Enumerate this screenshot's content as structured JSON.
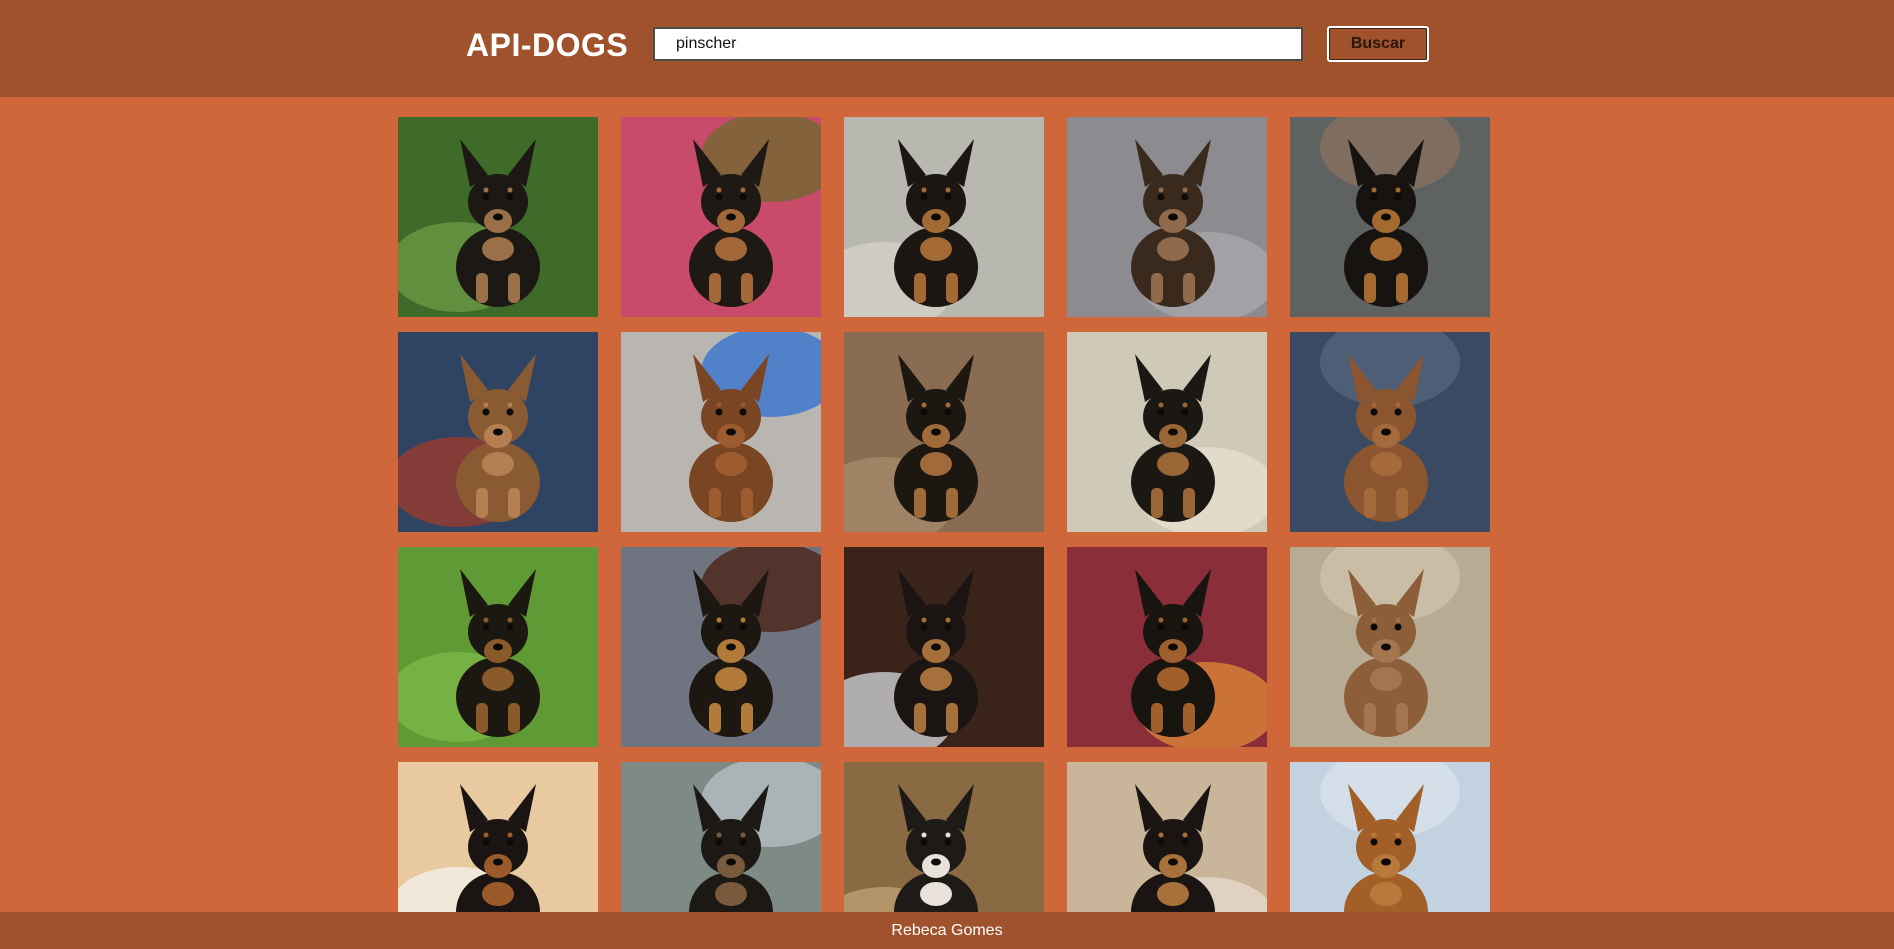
{
  "header": {
    "logo": "API-DOGS",
    "search_value": "pinscher",
    "search_button_label": "Buscar"
  },
  "gallery": {
    "photos": [
      {
        "background": "#3f6b2a",
        "accent": "#6f9b45",
        "dog": "#1c1814",
        "tan": "#9a7048"
      },
      {
        "background": "#c94b6a",
        "accent": "#6b6a2e",
        "dog": "#1e1915",
        "tan": "#a3683a"
      },
      {
        "background": "#b8b7b0",
        "accent": "#d6d3c8",
        "dog": "#1b1612",
        "tan": "#a36a34"
      },
      {
        "background": "#8c8b90",
        "accent": "#a9a8ad",
        "dog": "#3a2a1e",
        "tan": "#8f6a4c"
      },
      {
        "background": "#5e6361",
        "accent": "#8b7060",
        "dog": "#171310",
        "tan": "#a56a30"
      },
      {
        "background": "#2f4463",
        "accent": "#a03a2a",
        "dog": "#8a5a32",
        "tan": "#b48052"
      },
      {
        "background": "#b9b6b2",
        "accent": "#2f6fd0",
        "dog": "#7a4522",
        "tan": "#9c5c30"
      },
      {
        "background": "#8a6c52",
        "accent": "#a78a6c",
        "dog": "#1d1712",
        "tan": "#a06a3a"
      },
      {
        "background": "#cfc9b8",
        "accent": "#e8e0cf",
        "dog": "#1b1713",
        "tan": "#9a6636"
      },
      {
        "background": "#3a4a63",
        "accent": "#55657e",
        "dog": "#8b5530",
        "tan": "#a46a3c"
      },
      {
        "background": "#5f9a34",
        "accent": "#7db948",
        "dog": "#1b1812",
        "tan": "#8a5a2a"
      },
      {
        "background": "#6f7480",
        "accent": "#4a1f10",
        "dog": "#1d1712",
        "tan": "#b17a3a"
      },
      {
        "background": "#3a241a",
        "accent": "#d8dbe0",
        "dog": "#1a1512",
        "tan": "#a6703c"
      },
      {
        "background": "#8a2e3a",
        "accent": "#e08a3a",
        "dog": "#181410",
        "tan": "#a0602e"
      },
      {
        "background": "#b8ab94",
        "accent": "#cfc3ac",
        "dog": "#8c5f3a",
        "tan": "#a47650"
      },
      {
        "background": "#e9c9a0",
        "accent": "#f4f1ec",
        "dog": "#1a1512",
        "tan": "#9b5a2a"
      },
      {
        "background": "#7d8a86",
        "accent": "#b9c0c4",
        "dog": "#1c1915",
        "tan": "#7a5a3c"
      },
      {
        "background": "#8a6a42",
        "accent": "#c2a478",
        "dog": "#1d1a18",
        "tan": "#e8e2da"
      },
      {
        "background": "#c9b59a",
        "accent": "#e6dccd",
        "dog": "#1a1512",
        "tan": "#a8703a"
      },
      {
        "background": "#c3d2e0",
        "accent": "#d8e2ec",
        "dog": "#a35f28",
        "tan": "#b87a3a"
      }
    ]
  },
  "footer": {
    "text": "Rebeca Gomes"
  }
}
